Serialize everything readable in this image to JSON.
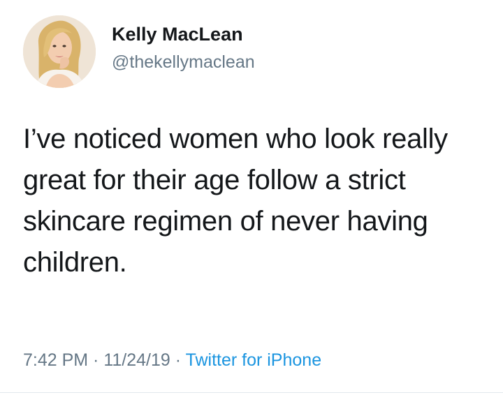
{
  "author": {
    "display_name": "Kelly MacLean",
    "handle": "@thekellymaclean"
  },
  "tweet": {
    "text": "I’ve noticed women who look really great for their age follow a strict skincare regimen of never having children."
  },
  "meta": {
    "time": "7:42 PM",
    "separator": " · ",
    "date": "11/24/19",
    "source": "Twitter for iPhone"
  },
  "colors": {
    "text": "#14171a",
    "secondary": "#657786",
    "link": "#1b95e0"
  }
}
